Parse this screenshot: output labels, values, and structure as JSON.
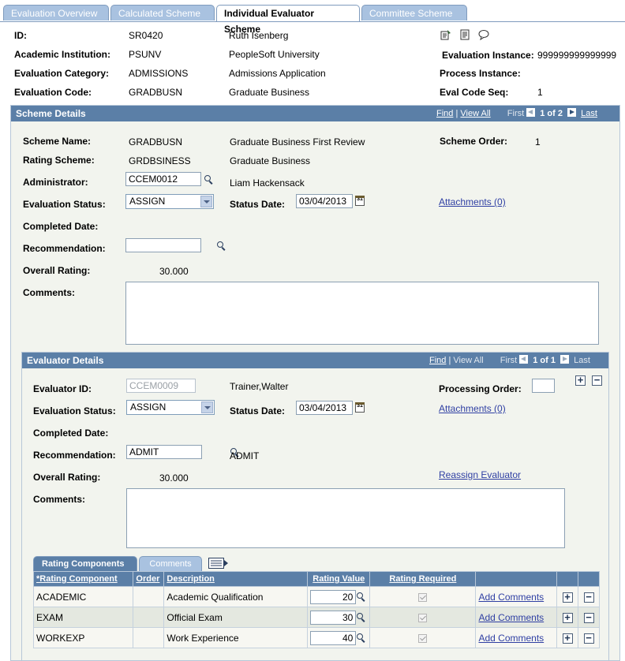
{
  "tabs": [
    "Evaluation Overview",
    "Calculated Scheme",
    "Individual Evaluator Scheme",
    "Committee Scheme"
  ],
  "header": {
    "id_label": "ID:",
    "id_value": "SR0420",
    "id_name": "Ruth Isenberg",
    "inst_label": "Academic Institution:",
    "inst_value": "PSUNV",
    "inst_name": "PeopleSoft University",
    "eval_inst_label": "Evaluation Instance:",
    "eval_inst_value": "999999999999999",
    "cat_label": "Evaluation Category:",
    "cat_value": "ADMISSIONS",
    "cat_name": "Admissions Application",
    "proc_inst_label": "Process Instance:",
    "code_label": "Evaluation Code:",
    "code_value": "GRADBUSN",
    "code_name": "Graduate Business",
    "seq_label": "Eval Code Seq:",
    "seq_value": "1"
  },
  "scheme": {
    "title": "Scheme Details",
    "nav": {
      "find": "Find",
      "sep": "|",
      "view_all": "View All",
      "first": "First",
      "count": "1 of 2",
      "last": "Last"
    },
    "name_label": "Scheme Name:",
    "name_value": "GRADBUSN",
    "name_desc": "Graduate Business First Review",
    "order_label": "Scheme Order:",
    "order_value": "1",
    "rating_label": "Rating Scheme:",
    "rating_value": "GRDBSINESS",
    "rating_desc": "Graduate Business",
    "admin_label": "Administrator:",
    "admin_value": "CCEM0012",
    "admin_name": "Liam Hackensack",
    "status_label": "Evaluation Status:",
    "status_value": "ASSIGN",
    "status_date_label": "Status Date:",
    "status_date_value": "03/04/2013",
    "attachments": "Attachments (0)",
    "completed_label": "Completed Date:",
    "rec_label": "Recommendation:",
    "rec_value": "",
    "overall_label": "Overall Rating:",
    "overall_value": "30.000",
    "comments_label": "Comments:"
  },
  "evaluator": {
    "title": "Evaluator Details",
    "nav": {
      "find": "Find",
      "sep": "|",
      "view_all": "View All",
      "first": "First",
      "count": "1 of 1",
      "last": "Last"
    },
    "id_label": "Evaluator ID:",
    "id_value": "CCEM0009",
    "id_name": "Trainer,Walter",
    "proc_order_label": "Processing Order:",
    "status_label": "Evaluation Status:",
    "status_value": "ASSIGN",
    "status_date_label": "Status Date:",
    "status_date_value": "03/04/2013",
    "attachments": "Attachments (0)",
    "completed_label": "Completed Date:",
    "rec_label": "Recommendation:",
    "rec_value": "ADMIT",
    "rec_desc": "ADMIT",
    "overall_label": "Overall Rating:",
    "overall_value": "30.000",
    "reassign": "Reassign Evaluator",
    "comments_label": "Comments:"
  },
  "grid": {
    "tabs": [
      "Rating Components",
      "Comments"
    ],
    "columns": [
      "*Rating Component",
      "Order",
      "Description",
      "Rating Value",
      "Rating Required"
    ],
    "add_comments": "Add Comments",
    "rows": [
      {
        "component": "ACADEMIC",
        "order": "",
        "description": "Academic Qualification",
        "value": "20"
      },
      {
        "component": "EXAM",
        "order": "",
        "description": "Official Exam",
        "value": "30"
      },
      {
        "component": "WORKEXP",
        "order": "",
        "description": "Work Experience",
        "value": "40"
      }
    ]
  },
  "calendar_glyph": "31"
}
